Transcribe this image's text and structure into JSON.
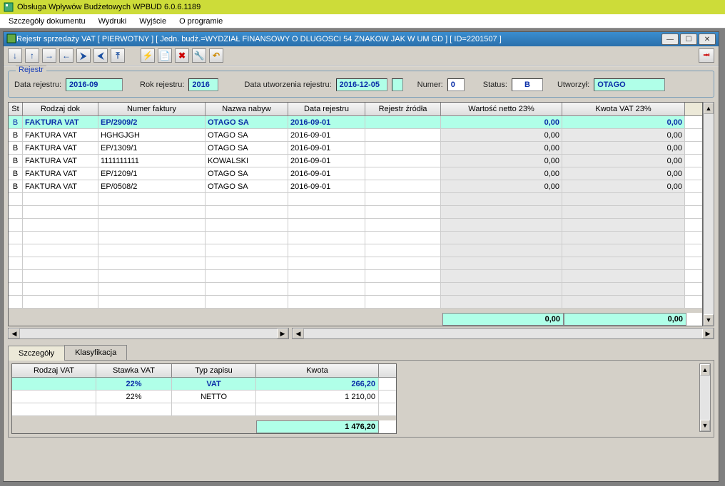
{
  "window": {
    "title": "Obsługa Wpływów Budżetowych WPBUD 6.0.6.1189"
  },
  "menubar": [
    "Szczegóły dokumentu",
    "Wydruki",
    "Wyjście",
    "O programie"
  ],
  "mdi": {
    "title": "Rejestr sprzedaży VAT [ PIERWOTNY ] [ Jedn. budż.=WYDZIAŁ FINANSOWY O DLUGOSCI 54 ZNAKOW JAK W UM GD ] [ ID=2201507 ]"
  },
  "register": {
    "legend": "Rejestr",
    "data_label": "Data rejestru:",
    "data_val": "2016-09",
    "rok_label": "Rok rejestru:",
    "rok_val": "2016",
    "utworz_label": "Data utworzenia rejestru:",
    "utworz_val": "2016-12-05",
    "numer_label": "Numer:",
    "numer_val": "0",
    "status_label": "Status:",
    "status_val": "B",
    "utworzyl_label": "Utworzył:",
    "utworzyl_val": "OTAGO"
  },
  "grid": {
    "headers": {
      "st": "St",
      "rodzaj": "Rodzaj dok",
      "numer": "Numer faktury",
      "nazwa": "Nazwa nabyw",
      "datar": "Data rejestru",
      "zrodlo": "Rejestr źródła",
      "netto": "Wartość netto 23%",
      "vat": "Kwota VAT 23%"
    },
    "rows": [
      {
        "st": "B",
        "rodzaj": "FAKTURA VAT",
        "numer": "EP/2909/2",
        "nazwa": "OTAGO SA",
        "datar": "2016-09-01",
        "zrodlo": "",
        "netto": "0,00",
        "vat": "0,00",
        "sel": true
      },
      {
        "st": "B",
        "rodzaj": "FAKTURA VAT",
        "numer": "HGHGJGH",
        "nazwa": "OTAGO SA",
        "datar": "2016-09-01",
        "zrodlo": "",
        "netto": "0,00",
        "vat": "0,00"
      },
      {
        "st": "B",
        "rodzaj": "FAKTURA VAT",
        "numer": "EP/1309/1",
        "nazwa": "OTAGO SA",
        "datar": "2016-09-01",
        "zrodlo": "",
        "netto": "0,00",
        "vat": "0,00"
      },
      {
        "st": "B",
        "rodzaj": "FAKTURA VAT",
        "numer": "1111111111",
        "nazwa": "KOWALSKI",
        "datar": "2016-09-01",
        "zrodlo": "",
        "netto": "0,00",
        "vat": "0,00"
      },
      {
        "st": "B",
        "rodzaj": "FAKTURA VAT",
        "numer": "EP/1209/1",
        "nazwa": "OTAGO SA",
        "datar": "2016-09-01",
        "zrodlo": "",
        "netto": "0,00",
        "vat": "0,00"
      },
      {
        "st": "B",
        "rodzaj": "FAKTURA VAT",
        "numer": "EP/0508/2",
        "nazwa": "OTAGO SA",
        "datar": "2016-09-01",
        "zrodlo": "",
        "netto": "0,00",
        "vat": "0,00"
      }
    ],
    "totals": {
      "netto": "0,00",
      "vat": "0,00"
    }
  },
  "tabs": {
    "szczegoly": "Szczegóły",
    "klasyfikacja": "Klasyfikacja"
  },
  "detail": {
    "headers": {
      "rodzaj": "Rodzaj VAT",
      "stawka": "Stawka VAT",
      "typ": "Typ zapisu",
      "kwota": "Kwota"
    },
    "rows": [
      {
        "rodzaj": "",
        "stawka": "22%",
        "typ": "VAT",
        "kwota": "266,20",
        "sel": true
      },
      {
        "rodzaj": "",
        "stawka": "22%",
        "typ": "NETTO",
        "kwota": "1 210,00"
      }
    ],
    "total": "1 476,20"
  }
}
